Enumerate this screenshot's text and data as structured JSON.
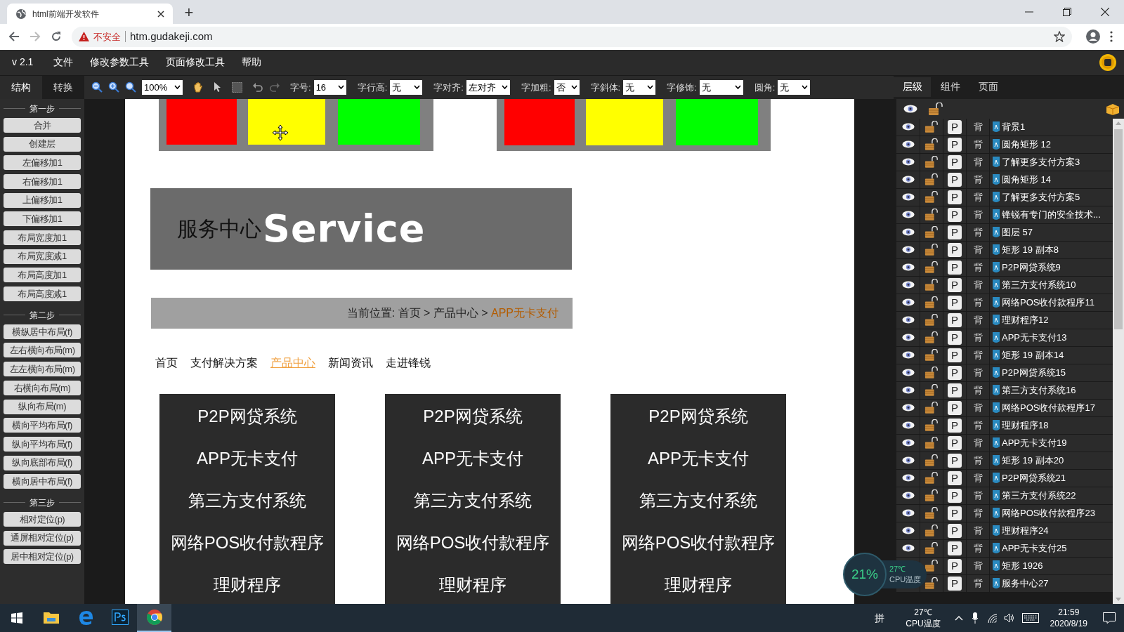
{
  "browser": {
    "tab_title": "html前端开发软件",
    "new_tab": "+",
    "security": "不安全",
    "url": "htm.gudakeji.com"
  },
  "menu": {
    "version": "v 2.1",
    "items": [
      "文件",
      "修改参数工具",
      "页面修改工具",
      "帮助"
    ]
  },
  "toolbar": {
    "zoom": "100%",
    "fields": [
      {
        "label": "字号:",
        "value": "16"
      },
      {
        "label": "字行高:",
        "value": "无"
      },
      {
        "label": "字对齐:",
        "value": "左对齐"
      },
      {
        "label": "字加粗:",
        "value": "否"
      },
      {
        "label": "字斜体:",
        "value": "无"
      },
      {
        "label": "字修饰:",
        "value": "无"
      },
      {
        "label": "圆角:",
        "value": "无"
      }
    ]
  },
  "sidebar": {
    "tabs": [
      {
        "label": "结构",
        "selected": true
      },
      {
        "label": "转换",
        "selected": false
      }
    ],
    "sections": [
      {
        "heading": "第一步",
        "buttons": [
          "合并",
          "创建层",
          "左偏移加1",
          "右偏移加1",
          "上偏移加1",
          "下偏移加1",
          "布局宽度加1",
          "布局宽度减1",
          "布局高度加1",
          "布局高度减1"
        ]
      },
      {
        "heading": "第二步",
        "buttons": [
          "横纵居中布局(f)",
          "左右横向布局(m)",
          "左左横向布局(m)",
          "右横向布局(m)",
          "纵向布局(m)",
          "横向平均布局(f)",
          "纵向平均布局(f)",
          "纵向底部布局(f)",
          "横向居中布局(f)"
        ]
      },
      {
        "heading": "第三步",
        "buttons": [
          "相对定位(p)",
          "通屏相对定位(p)",
          "居中相对定位(p)"
        ]
      }
    ]
  },
  "canvas": {
    "banner": {
      "cn": "服务中心",
      "en": "Service"
    },
    "breadcrumb": {
      "prefix": "当前位置: 首页 > 产品中心 > ",
      "current": "APP无卡支付"
    },
    "nav": [
      {
        "label": "首页",
        "selected": false
      },
      {
        "label": "支付解决方案",
        "selected": false
      },
      {
        "label": "产品中心",
        "selected": true
      },
      {
        "label": "新闻资讯",
        "selected": false
      },
      {
        "label": "走进锋锐",
        "selected": false
      }
    ],
    "cards": [
      {
        "items": [
          "P2P网贷系统",
          "APP无卡支付",
          "第三方支付系统",
          "网络POS收付款程序",
          "理财程序"
        ]
      },
      {
        "items": [
          "P2P网贷系统",
          "APP无卡支付",
          "第三方支付系统",
          "网络POS收付款程序",
          "理财程序"
        ]
      },
      {
        "items": [
          "P2P网贷系统",
          "APP无卡支付",
          "第三方支付系统",
          "网络POS收付款程序",
          "理财程序"
        ]
      }
    ]
  },
  "layers": {
    "tabs": [
      {
        "label": "层级",
        "selected": true
      },
      {
        "label": "组件",
        "selected": false
      },
      {
        "label": "页面",
        "selected": false
      }
    ],
    "rows": [
      {
        "type": "P",
        "mode": "背",
        "name": "背景1"
      },
      {
        "type": "P",
        "mode": "背",
        "name": "圆角矩形 12"
      },
      {
        "type": "P",
        "mode": "背",
        "name": "了解更多支付方案3"
      },
      {
        "type": "P",
        "mode": "背",
        "name": "圆角矩形 14"
      },
      {
        "type": "P",
        "mode": "背",
        "name": "了解更多支付方案5"
      },
      {
        "type": "P",
        "mode": "背",
        "name": "锋锐有专门的安全技术..."
      },
      {
        "type": "P",
        "mode": "背",
        "name": "图层 57"
      },
      {
        "type": "P",
        "mode": "背",
        "name": "矩形 19 副本8"
      },
      {
        "type": "P",
        "mode": "背",
        "name": "P2P网贷系统9"
      },
      {
        "type": "P",
        "mode": "背",
        "name": "第三方支付系统10"
      },
      {
        "type": "P",
        "mode": "背",
        "name": "网络POS收付款程序11"
      },
      {
        "type": "P",
        "mode": "背",
        "name": "理财程序12"
      },
      {
        "type": "P",
        "mode": "背",
        "name": "APP无卡支付13"
      },
      {
        "type": "P",
        "mode": "背",
        "name": "矩形 19 副本14"
      },
      {
        "type": "P",
        "mode": "背",
        "name": "P2P网贷系统15"
      },
      {
        "type": "P",
        "mode": "背",
        "name": "第三方支付系统16"
      },
      {
        "type": "P",
        "mode": "背",
        "name": "网络POS收付款程序17"
      },
      {
        "type": "P",
        "mode": "背",
        "name": "理财程序18"
      },
      {
        "type": "P",
        "mode": "背",
        "name": "APP无卡支付19"
      },
      {
        "type": "P",
        "mode": "背",
        "name": "矩形 19 副本20"
      },
      {
        "type": "P",
        "mode": "背",
        "name": "P2P网贷系统21"
      },
      {
        "type": "P",
        "mode": "背",
        "name": "第三方支付系统22"
      },
      {
        "type": "P",
        "mode": "背",
        "name": "网络POS收付款程序23"
      },
      {
        "type": "P",
        "mode": "背",
        "name": "理财程序24"
      },
      {
        "type": "P",
        "mode": "背",
        "name": "APP无卡支付25"
      },
      {
        "type": "P",
        "mode": "背",
        "name": "矩形 1926"
      },
      {
        "type": "P",
        "mode": "背",
        "name": "服务中心27"
      }
    ]
  },
  "cpu_widget": {
    "percent": "21%",
    "temp": "27℃",
    "label": "CPU温度"
  },
  "taskbar": {
    "apps": [
      {
        "kind": "files",
        "selected": false
      },
      {
        "kind": "edge",
        "selected": false
      },
      {
        "kind": "ps",
        "selected": false
      },
      {
        "kind": "chrome",
        "selected": true
      }
    ],
    "ime": "拼",
    "temp": "27℃",
    "temp_label": "CPU温度",
    "time": "21:59",
    "date": "2020/8/19"
  }
}
